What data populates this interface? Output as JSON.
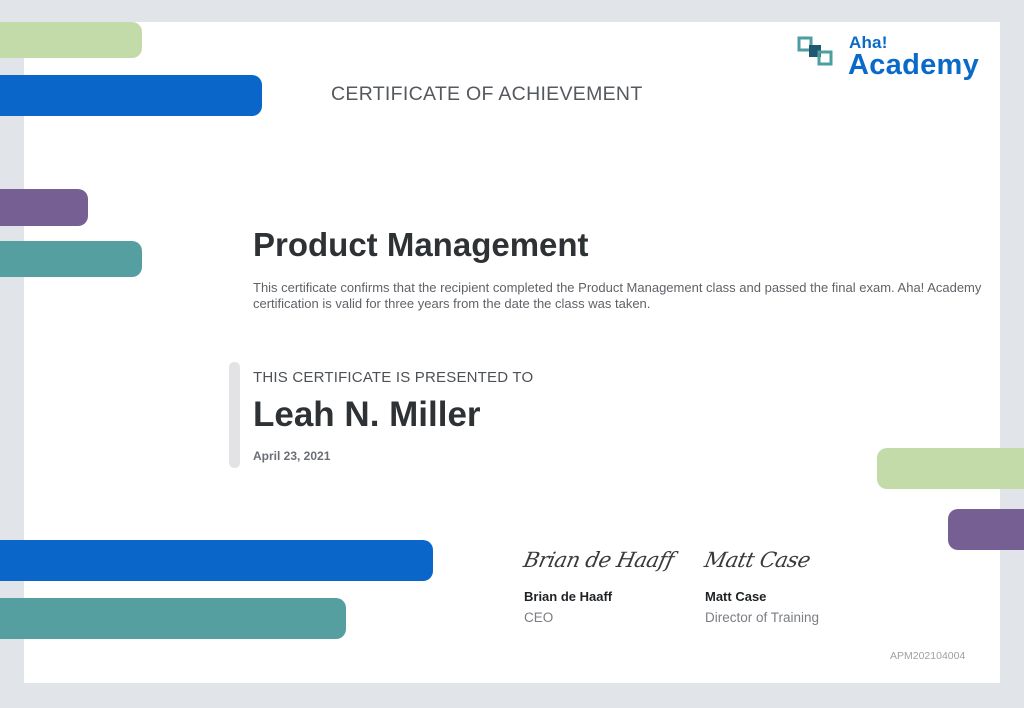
{
  "colors": {
    "background": "#e1e5ea",
    "sheet": "#ffffff",
    "bar_green": "#c2dba8",
    "bar_blue": "#0a67c9",
    "bar_purple": "#765f93",
    "bar_teal": "#559fa1",
    "logo_blue": "#0a6ac9",
    "logo_teal": "#4d9ea0",
    "logo_dark": "#1f5870"
  },
  "logo": {
    "icon": "aha-overlapping-squares-icon",
    "small_text": "Aha!",
    "big_text": "Academy"
  },
  "certificate": {
    "heading": "CERTIFICATE OF ACHIEVEMENT",
    "course_title": "Product Management",
    "description": "This certificate confirms that the recipient completed the Product Management class and passed the final exam. Aha! Academy certification is valid for three years from the date the class was taken.",
    "presented_label": "THIS CERTIFICATE IS PRESENTED TO",
    "recipient": "Leah N. Miller",
    "date": "April 23, 2021",
    "id": "APM202104004"
  },
  "signatures": [
    {
      "script": "Brian de Haaff",
      "name": "Brian de Haaff",
      "role": "CEO"
    },
    {
      "script": "Matt Case",
      "name": "Matt Case",
      "role": "Director of Training"
    }
  ]
}
